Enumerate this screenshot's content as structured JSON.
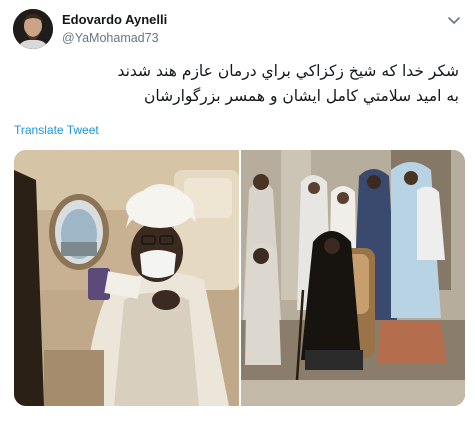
{
  "user": {
    "display_name": "Edovardo Aynelli",
    "handle": "@YaMohamad73",
    "avatar_icon": "profile-avatar"
  },
  "tweet": {
    "text_line_1": "شکر خدا که شيخ زکزاکي براي درمان عازم هند شدند",
    "text_line_2": "به اميد سلامتي کامل ايشان و همسر بزرگوارشان",
    "translate_label": "Translate Tweet",
    "menu_icon": "chevron-down-icon"
  },
  "media": {
    "photos": [
      {
        "subject": "man in white turban and face mask seated in airplane cabin"
      },
      {
        "subject": "group of people in headscarves, woman seated in chair on porch"
      }
    ]
  },
  "colors": {
    "link": "#1b95e0",
    "secondary_text": "#657786",
    "primary_text": "#14171a"
  }
}
